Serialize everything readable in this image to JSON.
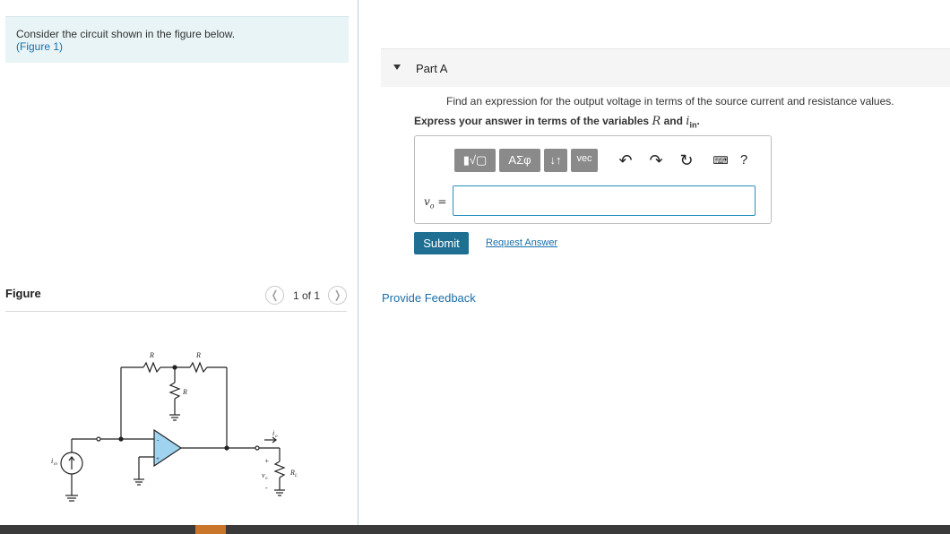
{
  "intro": {
    "text": "Consider the circuit shown in the figure below.",
    "figure_link": "(Figure 1)"
  },
  "figure": {
    "heading": "Figure",
    "pager": "1 of 1",
    "prev_icon": "chevron-left-icon",
    "next_icon": "chevron-right-icon",
    "circuit_labels": {
      "r_top_left": "R",
      "r_top_right": "R",
      "r_vertical": "R",
      "source": "i",
      "source_sub": "in",
      "current_out": "i",
      "current_out_sub": "o",
      "plus": "+",
      "minus": "-",
      "vout": "v",
      "vout_sub": "o",
      "load": "R",
      "load_sub": "L",
      "opamp_minus": "-",
      "opamp_plus": "+"
    }
  },
  "part": {
    "title": "Part A",
    "question": "Find an expression for the output voltage in terms of the source current and resistance values.",
    "express_prefix": "Express your answer in terms of the variables ",
    "var_r": "R",
    "express_and": " and ",
    "var_i": "i",
    "var_i_sub": "in",
    "express_suffix": "."
  },
  "toolbar": {
    "templates": "▮√▢",
    "greek": "ΑΣφ",
    "arrows": "↓↑",
    "vec": "vec",
    "undo_icon": "undo-icon",
    "redo_icon": "redo-icon",
    "reset_icon": "reset-icon",
    "keyboard_icon": "keyboard-icon",
    "help": "?"
  },
  "answer": {
    "label": "v",
    "label_sub": "o",
    "equals": " =",
    "value": ""
  },
  "buttons": {
    "submit": "Submit",
    "request": "Request Answer"
  },
  "feedback": "Provide Feedback"
}
